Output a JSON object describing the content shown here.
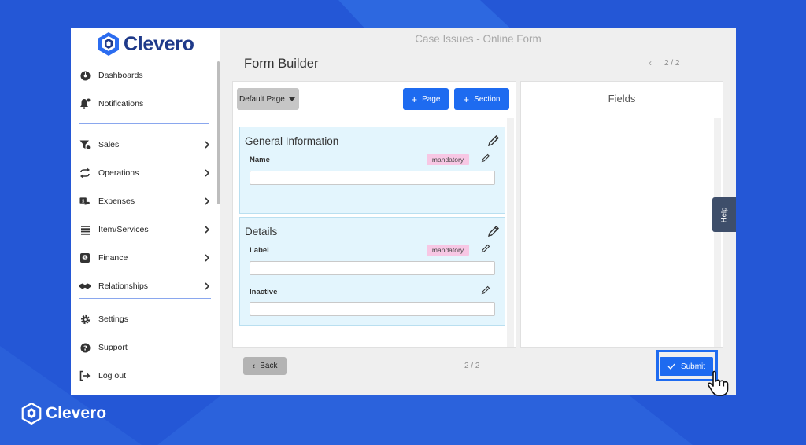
{
  "brand": {
    "name": "Clevero"
  },
  "colors": {
    "accent": "#1e6bf0",
    "background": "#2457d6",
    "section_bg": "#e3f5fd",
    "badge_bg": "#f7c7e4"
  },
  "sidebar": {
    "items": [
      {
        "label": "Dashboards",
        "icon": "dashboard-icon",
        "has_submenu": false
      },
      {
        "label": "Notifications",
        "icon": "bell-icon",
        "has_submenu": false
      },
      {
        "label": "Sales",
        "icon": "funnel-icon",
        "has_submenu": true
      },
      {
        "label": "Operations",
        "icon": "cycle-icon",
        "has_submenu": true
      },
      {
        "label": "Expenses",
        "icon": "money-icon",
        "has_submenu": true
      },
      {
        "label": "Item/Services",
        "icon": "list-icon",
        "has_submenu": true
      },
      {
        "label": "Finance",
        "icon": "finance-icon",
        "has_submenu": true
      },
      {
        "label": "Relationships",
        "icon": "handshake-icon",
        "has_submenu": true
      },
      {
        "label": "Settings",
        "icon": "gear-icon",
        "has_submenu": false
      },
      {
        "label": "Support",
        "icon": "question-icon",
        "has_submenu": false
      },
      {
        "label": "Log out",
        "icon": "logout-icon",
        "has_submenu": false
      }
    ]
  },
  "header": {
    "title": "Case Issues - Online Form"
  },
  "main": {
    "title": "Form Builder",
    "pager": "2 / 2",
    "toolbar": {
      "page_select": "Default Page",
      "add_page_label": "Page",
      "add_section_label": "Section"
    },
    "sections": [
      {
        "title": "General Information",
        "fields": [
          {
            "label": "Name",
            "badge": "mandatory",
            "value": ""
          }
        ]
      },
      {
        "title": "Details",
        "fields": [
          {
            "label": "Label",
            "badge": "mandatory",
            "value": ""
          },
          {
            "label": "Inactive",
            "badge": "",
            "value": ""
          }
        ]
      }
    ],
    "fields_panel": {
      "title": "Fields"
    },
    "help_label": "Help",
    "footer": {
      "back_label": "Back",
      "pager": "2 / 2",
      "submit_label": "Submit"
    }
  }
}
